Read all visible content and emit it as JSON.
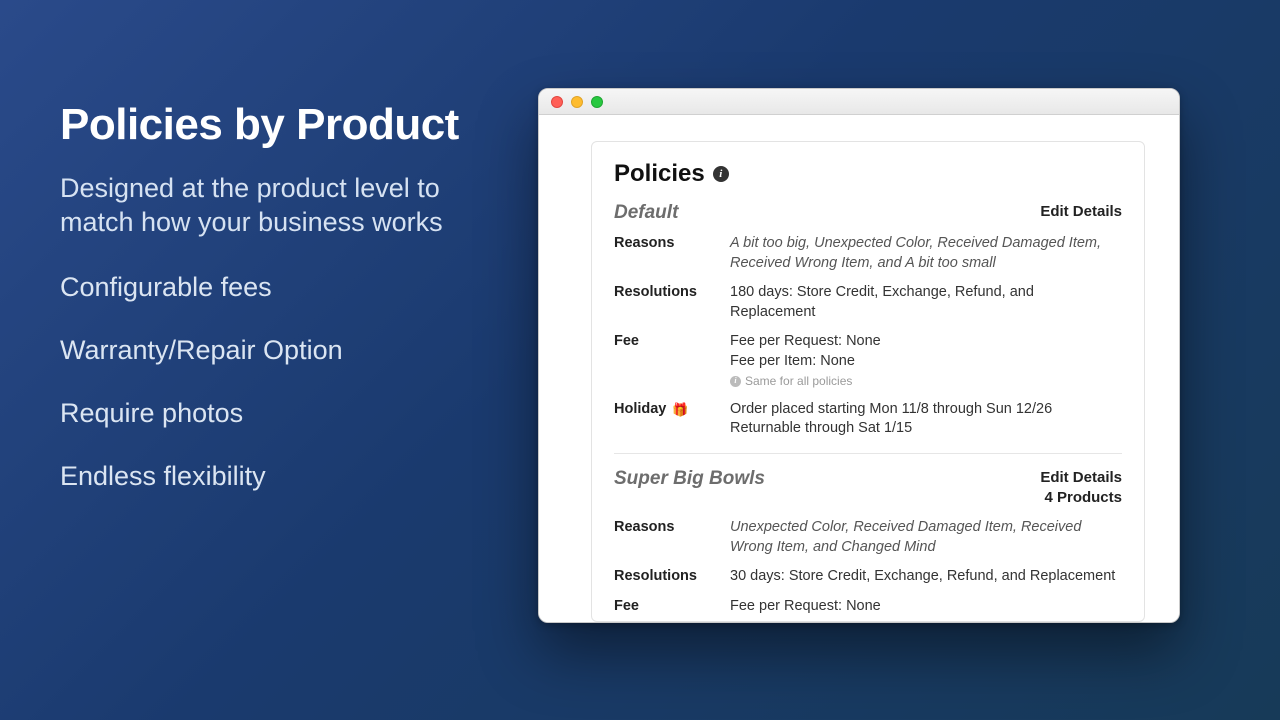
{
  "marketing": {
    "title": "Policies by Product",
    "subtitle": "Designed at the product level to match how your business works",
    "bullets": [
      "Configurable fees",
      "Warranty/Repair Option",
      "Require photos",
      "Endless flexibility"
    ]
  },
  "panel": {
    "title": "Policies",
    "info_glyph": "i",
    "sections": [
      {
        "name": "Default",
        "edit_label": "Edit Details",
        "products_label": "",
        "rows": {
          "reasons_label": "Reasons",
          "reasons_value": "A bit too big, Unexpected Color, Received Damaged Item, Received Wrong Item, and A bit too small",
          "resolutions_label": "Resolutions",
          "resolutions_value": "180 days: Store Credit, Exchange, Refund, and Replacement",
          "fee_label": "Fee",
          "fee_value_1": "Fee per Request: None",
          "fee_value_2": "Fee per Item: None",
          "fee_hint": "Same for all policies",
          "holiday_label": "Holiday",
          "holiday_value_1": "Order placed starting Mon 11/8 through Sun 12/26",
          "holiday_value_2": "Returnable through Sat 1/15"
        }
      },
      {
        "name": "Super Big Bowls",
        "edit_label": "Edit Details",
        "products_label": "4 Products",
        "rows": {
          "reasons_label": "Reasons",
          "reasons_value": "Unexpected Color, Received Damaged Item, Received Wrong Item, and Changed Mind",
          "resolutions_label": "Resolutions",
          "resolutions_value": "30 days: Store Credit, Exchange, Refund, and Replacement",
          "fee_label": "Fee",
          "fee_value_1": "Fee per Request: None"
        }
      }
    ]
  }
}
